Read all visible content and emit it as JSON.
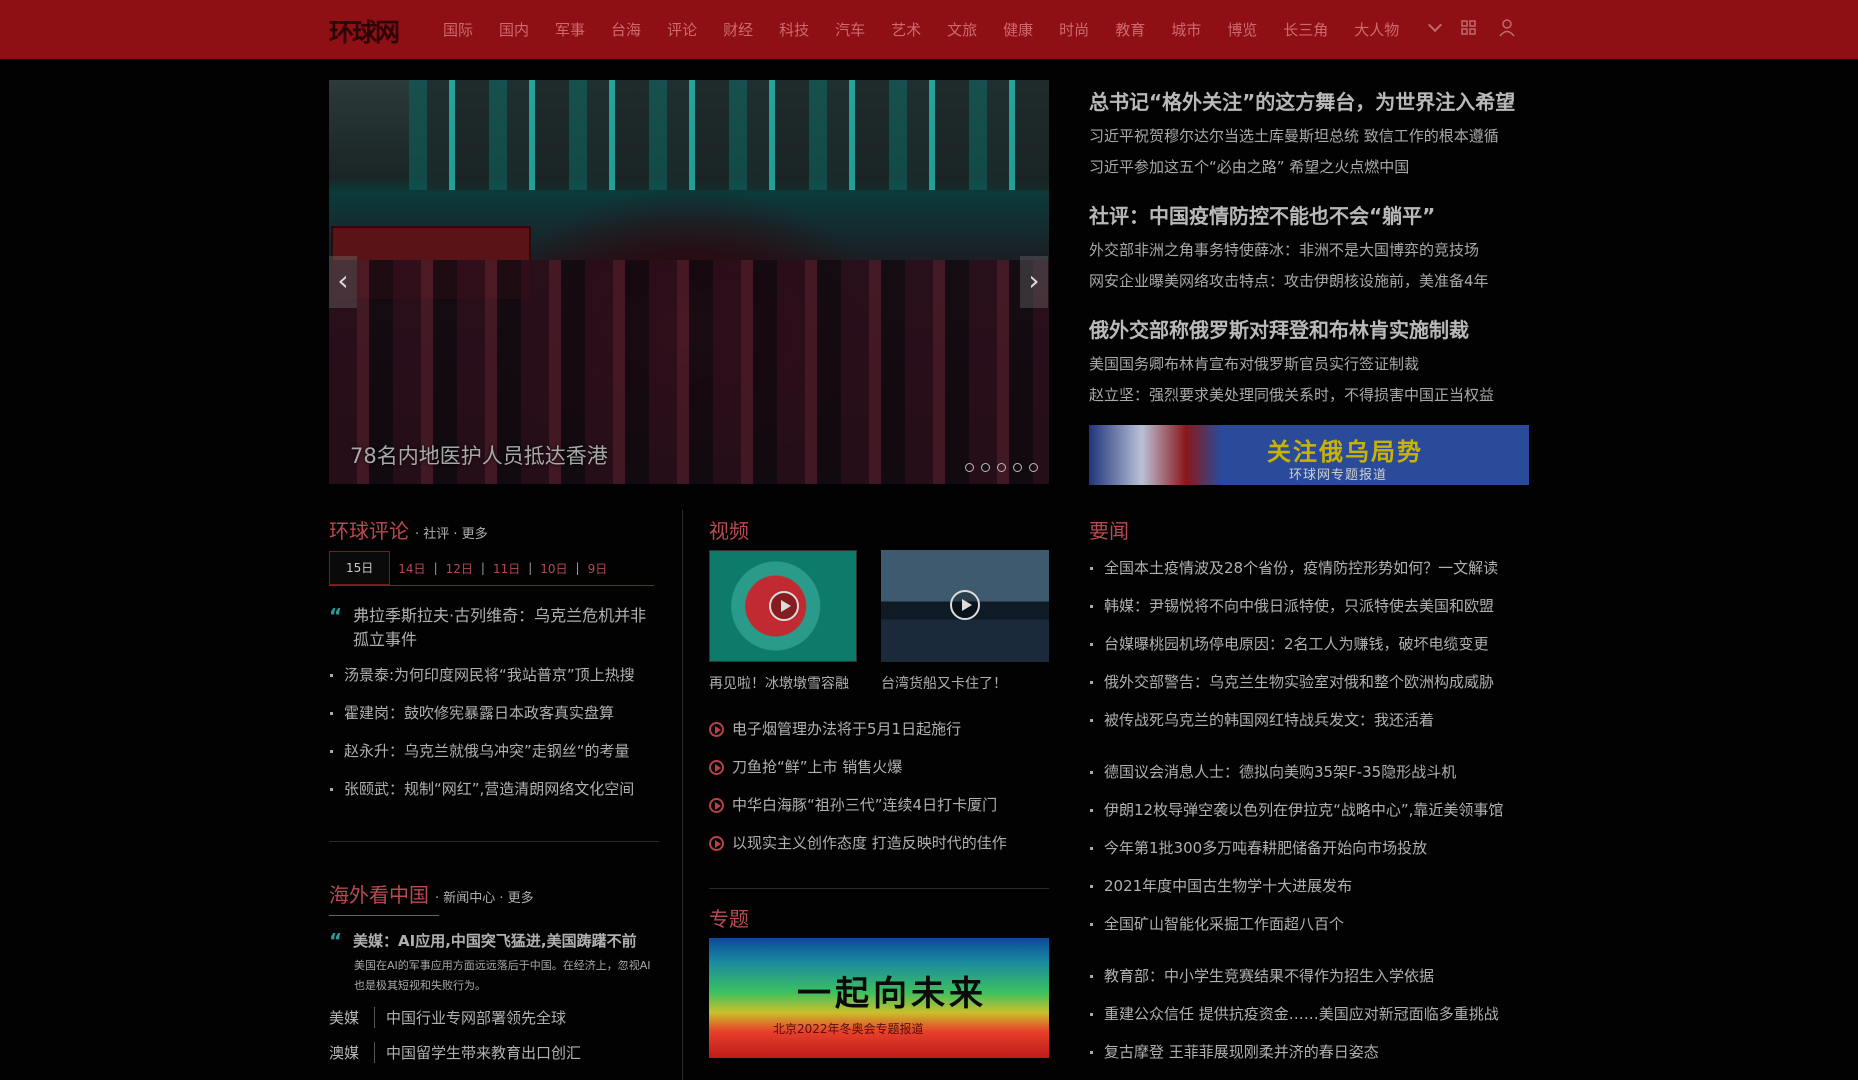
{
  "header": {
    "logo": "环球网",
    "nav": [
      "国际",
      "国内",
      "军事",
      "台海",
      "评论",
      "财经",
      "科技",
      "汽车",
      "艺术",
      "文旅",
      "健康",
      "时尚",
      "教育",
      "城市",
      "博览",
      "长三角",
      "大人物"
    ]
  },
  "slider": {
    "caption": "78名内地医护人员抵达香港",
    "prev": "‹",
    "next": "›"
  },
  "headlines": [
    {
      "title": "总书记“格外关注”的这方舞台，为世界注入希望",
      "subs": [
        "习近平祝贺穆尔达尔当选土库曼斯坦总统 致信工作的根本遵循",
        "习近平参加这五个“必由之路” 希望之火点燃中国"
      ]
    },
    {
      "title": "社评：中国疫情防控不能也不会“躺平”",
      "subs": [
        "外交部非洲之角事务特使薛冰：非洲不是大国博弈的竞技场",
        "网安企业曝美网络攻击特点：攻击伊朗核设施前，美准备4年"
      ]
    },
    {
      "title": "俄外交部称俄罗斯对拜登和布林肯实施制裁",
      "subs": [
        "美国国务卿布林肯宣布对俄罗斯官员实行签证制裁",
        "赵立坚：强烈要求美处理同俄关系时，不得损害中国正当权益"
      ]
    }
  ],
  "promo": {
    "title": "关注俄乌局势",
    "sub": "环球网专题报道"
  },
  "commentary": {
    "title": "环球评论",
    "meta": "· 社评 · 更多",
    "tabs": [
      "15日",
      "14日",
      "12日",
      "11日",
      "10日",
      "9日"
    ],
    "quote": "弗拉季斯拉夫·古列维奇：乌克兰危机并非孤立事件",
    "items": [
      "汤景泰:为何印度网民将“我站普京”顶上热搜",
      "霍建岗：鼓吹修宪暴露日本政客真实盘算",
      "赵永升：乌克兰就俄乌冲突”走钢丝“的考量",
      "张颐武：规制“网红”,营造清朗网络文化空间"
    ]
  },
  "foreign": {
    "title": "海外看中国",
    "meta": "· 新闻中心 · 更多",
    "quote": "美媒：AI应用,中国突飞猛进,美国踌躇不前",
    "quote_sub": "美国在AI的军事应用方面远远落后于中国。在经济上，忽视AI也是极其短视和失败行为。",
    "rows": [
      {
        "src": "美媒",
        "text": "中国行业专网部署领先全球"
      },
      {
        "src": "澳媒",
        "text": "中国留学生带来教育出口创汇"
      }
    ]
  },
  "video": {
    "title": "视频",
    "thumbs": [
      {
        "caption": "再见啦！冰墩墩雪容融"
      },
      {
        "caption": "台湾货船又卡住了！"
      }
    ],
    "items": [
      "电子烟管理办法将于5月1日起施行",
      "刀鱼抢“鲜”上市 销售火爆",
      "中华白海豚“祖孙三代”连续4日打卡厦门",
      "以现实主义创作态度 打造反映时代的佳作"
    ]
  },
  "topic": {
    "title": "专题",
    "image_title": "一起向未来",
    "image_sub": "北京2022年冬奥会专题报道"
  },
  "news": {
    "title": "要闻",
    "group1": [
      "全国本土疫情波及28个省份，疫情防控形势如何？一文解读",
      "韩媒：尹锡悦将不向中俄日派特使，只派特使去美国和欧盟",
      "台媒曝桃园机场停电原因：2名工人为赚钱，破坏电缆变更",
      "俄外交部警告：乌克兰生物实验室对俄和整个欧洲构成威胁",
      "被传战死乌克兰的韩国网红特战兵发文：我还活着"
    ],
    "group2": [
      "德国议会消息人士：德拟向美购35架F-35隐形战斗机",
      "伊朗12枚导弹空袭以色列在伊拉克“战略中心”,靠近美领事馆",
      "今年第1批300多万吨春耕肥储备开始向市场投放",
      "2021年度中国古生物学十大进展发布",
      "全国矿山智能化采掘工作面超八百个"
    ],
    "group3": [
      "教育部：中小学生竞赛结果不得作为招生入学依据",
      "重建公众信任 提供抗疫资金……美国应对新冠面临多重挑战",
      "复古摩登 王菲菲展现刚柔并济的春日姿态"
    ]
  },
  "colors": {
    "brand": "#8e0f14",
    "accent": "#b94a4f",
    "background": "#020202"
  }
}
